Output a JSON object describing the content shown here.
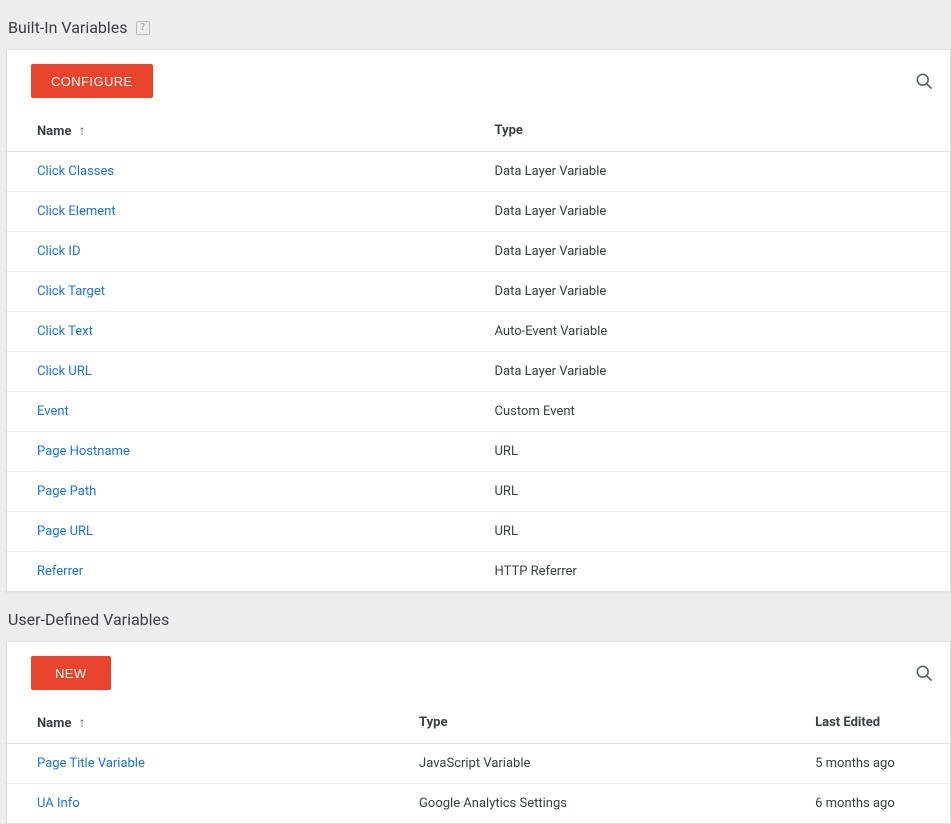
{
  "builtIn": {
    "title": "Built-In Variables",
    "configureLabel": "CONFIGURE",
    "columns": {
      "name": "Name",
      "type": "Type"
    },
    "rows": [
      {
        "name": "Click Classes",
        "type": "Data Layer Variable"
      },
      {
        "name": "Click Element",
        "type": "Data Layer Variable"
      },
      {
        "name": "Click ID",
        "type": "Data Layer Variable"
      },
      {
        "name": "Click Target",
        "type": "Data Layer Variable"
      },
      {
        "name": "Click Text",
        "type": "Auto-Event Variable"
      },
      {
        "name": "Click URL",
        "type": "Data Layer Variable"
      },
      {
        "name": "Event",
        "type": "Custom Event"
      },
      {
        "name": "Page Hostname",
        "type": "URL"
      },
      {
        "name": "Page Path",
        "type": "URL"
      },
      {
        "name": "Page URL",
        "type": "URL"
      },
      {
        "name": "Referrer",
        "type": "HTTP Referrer"
      }
    ]
  },
  "userDefined": {
    "title": "User-Defined Variables",
    "newLabel": "NEW",
    "columns": {
      "name": "Name",
      "type": "Type",
      "lastEdited": "Last Edited"
    },
    "rows": [
      {
        "name": "Page Title Variable",
        "type": "JavaScript Variable",
        "lastEdited": "5 months ago"
      },
      {
        "name": "UA Info",
        "type": "Google Analytics Settings",
        "lastEdited": "6 months ago"
      }
    ]
  },
  "helpGlyph": "?"
}
